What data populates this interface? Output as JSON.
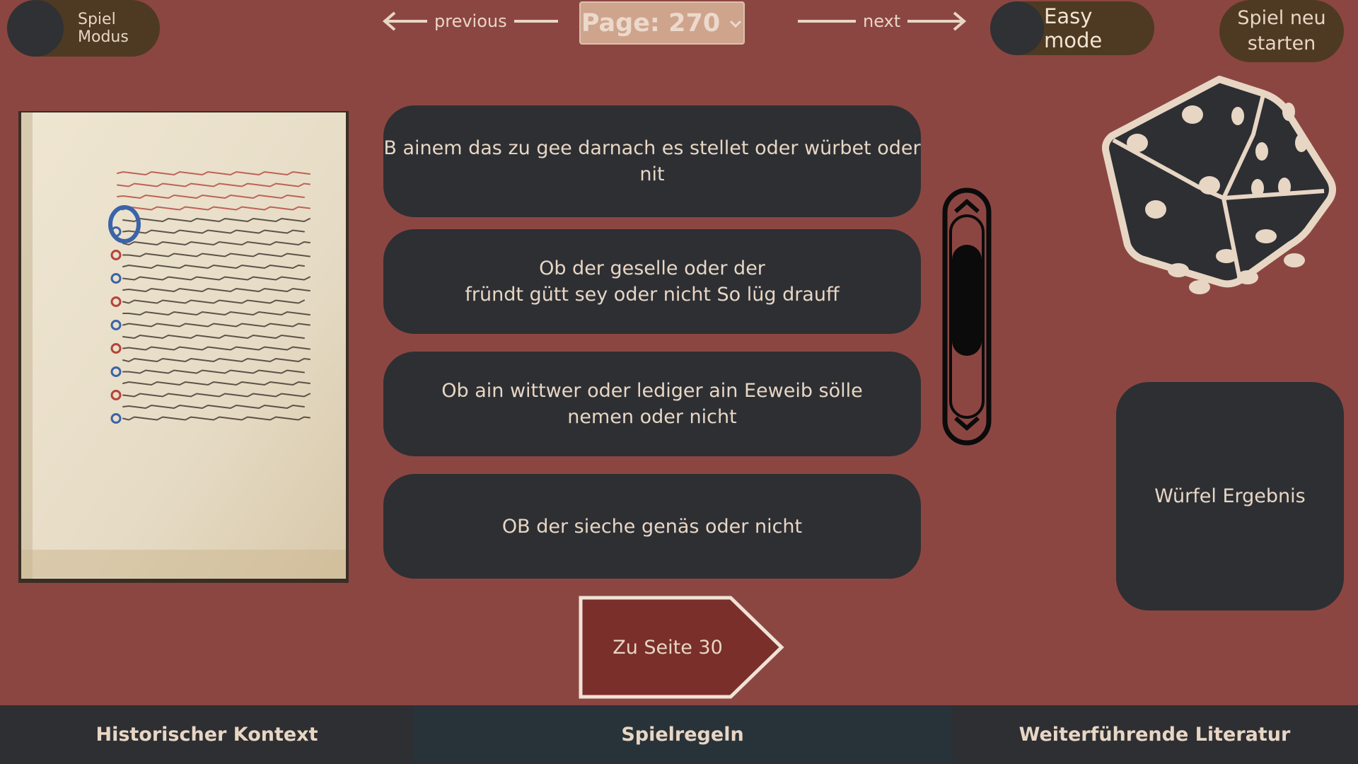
{
  "header": {
    "spiel_modus_label": "Spiel Modus",
    "previous_label": "previous",
    "next_label": "next",
    "page_select_value": "Page: 270",
    "easy_mode_label": "Easy mode",
    "restart_label_line1": "Spiel neu",
    "restart_label_line2": "starten"
  },
  "questions": [
    "B ainem das zu gee darnach es stellet oder würbet oder nit",
    "Ob der geselle oder der\nfründt  gütt sey oder nicht So lüg drauff",
    "Ob ain wittwer oder lediger ain Eeweib sölle\nnemen oder nicht",
    "OB der sieche genäs oder nicht"
  ],
  "dice_result_label": "Würfel Ergebnis",
  "goto_button_label": "Zu Seite 30",
  "bottom_nav": {
    "historical_context": "Historischer Kontext",
    "rules": "Spielregeln",
    "further_reading": "Weiterführende Literatur"
  },
  "colors": {
    "background": "#8c4642",
    "card": "#2d2f33",
    "toggle_track": "#4e3a22",
    "accent_button": "#7a2f2a",
    "text": "#e8d6c4"
  },
  "icons": {
    "previous": "arrow-left-icon",
    "next": "arrow-right-icon",
    "dropdown": "chevron-down-icon",
    "dice": "dice-icon"
  }
}
